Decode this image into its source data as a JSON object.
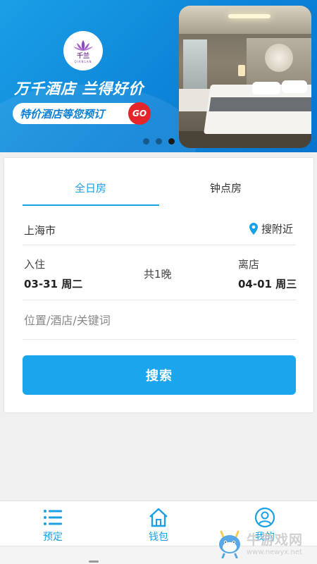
{
  "banner": {
    "logo_text": "千兰",
    "logo_sub": "QIANLAN",
    "slogan": "万千酒店 兰得好价",
    "promo": "特价酒店等您预订",
    "go": "GO",
    "slide_count": 3,
    "active_slide": 3,
    "colors": {
      "gradient_start": "#1b9fe6",
      "gradient_end": "#0a74cc",
      "go_badge": "#e3262a",
      "logo": "#7b3fa0"
    }
  },
  "tabs": {
    "all_day": "全日房",
    "hourly": "钟点房",
    "active": "all_day"
  },
  "city": {
    "name": "上海市",
    "nearby_label": "搜附近",
    "nearby_icon": "location-pin-icon"
  },
  "dates": {
    "checkin_label": "入住",
    "checkin_value": "03-31 周二",
    "nights": "共1晚",
    "checkout_label": "离店",
    "checkout_value": "04-01 周三"
  },
  "keyword": {
    "placeholder": "位置/酒店/关键词",
    "value": ""
  },
  "search_button": "搜索",
  "nav": {
    "book": {
      "label": "预定",
      "icon": "list-icon"
    },
    "wallet": {
      "label": "钱包",
      "icon": "home-icon"
    },
    "me": {
      "label": "我的",
      "icon": "user-icon"
    },
    "accent": "#1aa0e6"
  },
  "watermark": {
    "title": "牛游戏网",
    "url": "www.newyx.net"
  }
}
